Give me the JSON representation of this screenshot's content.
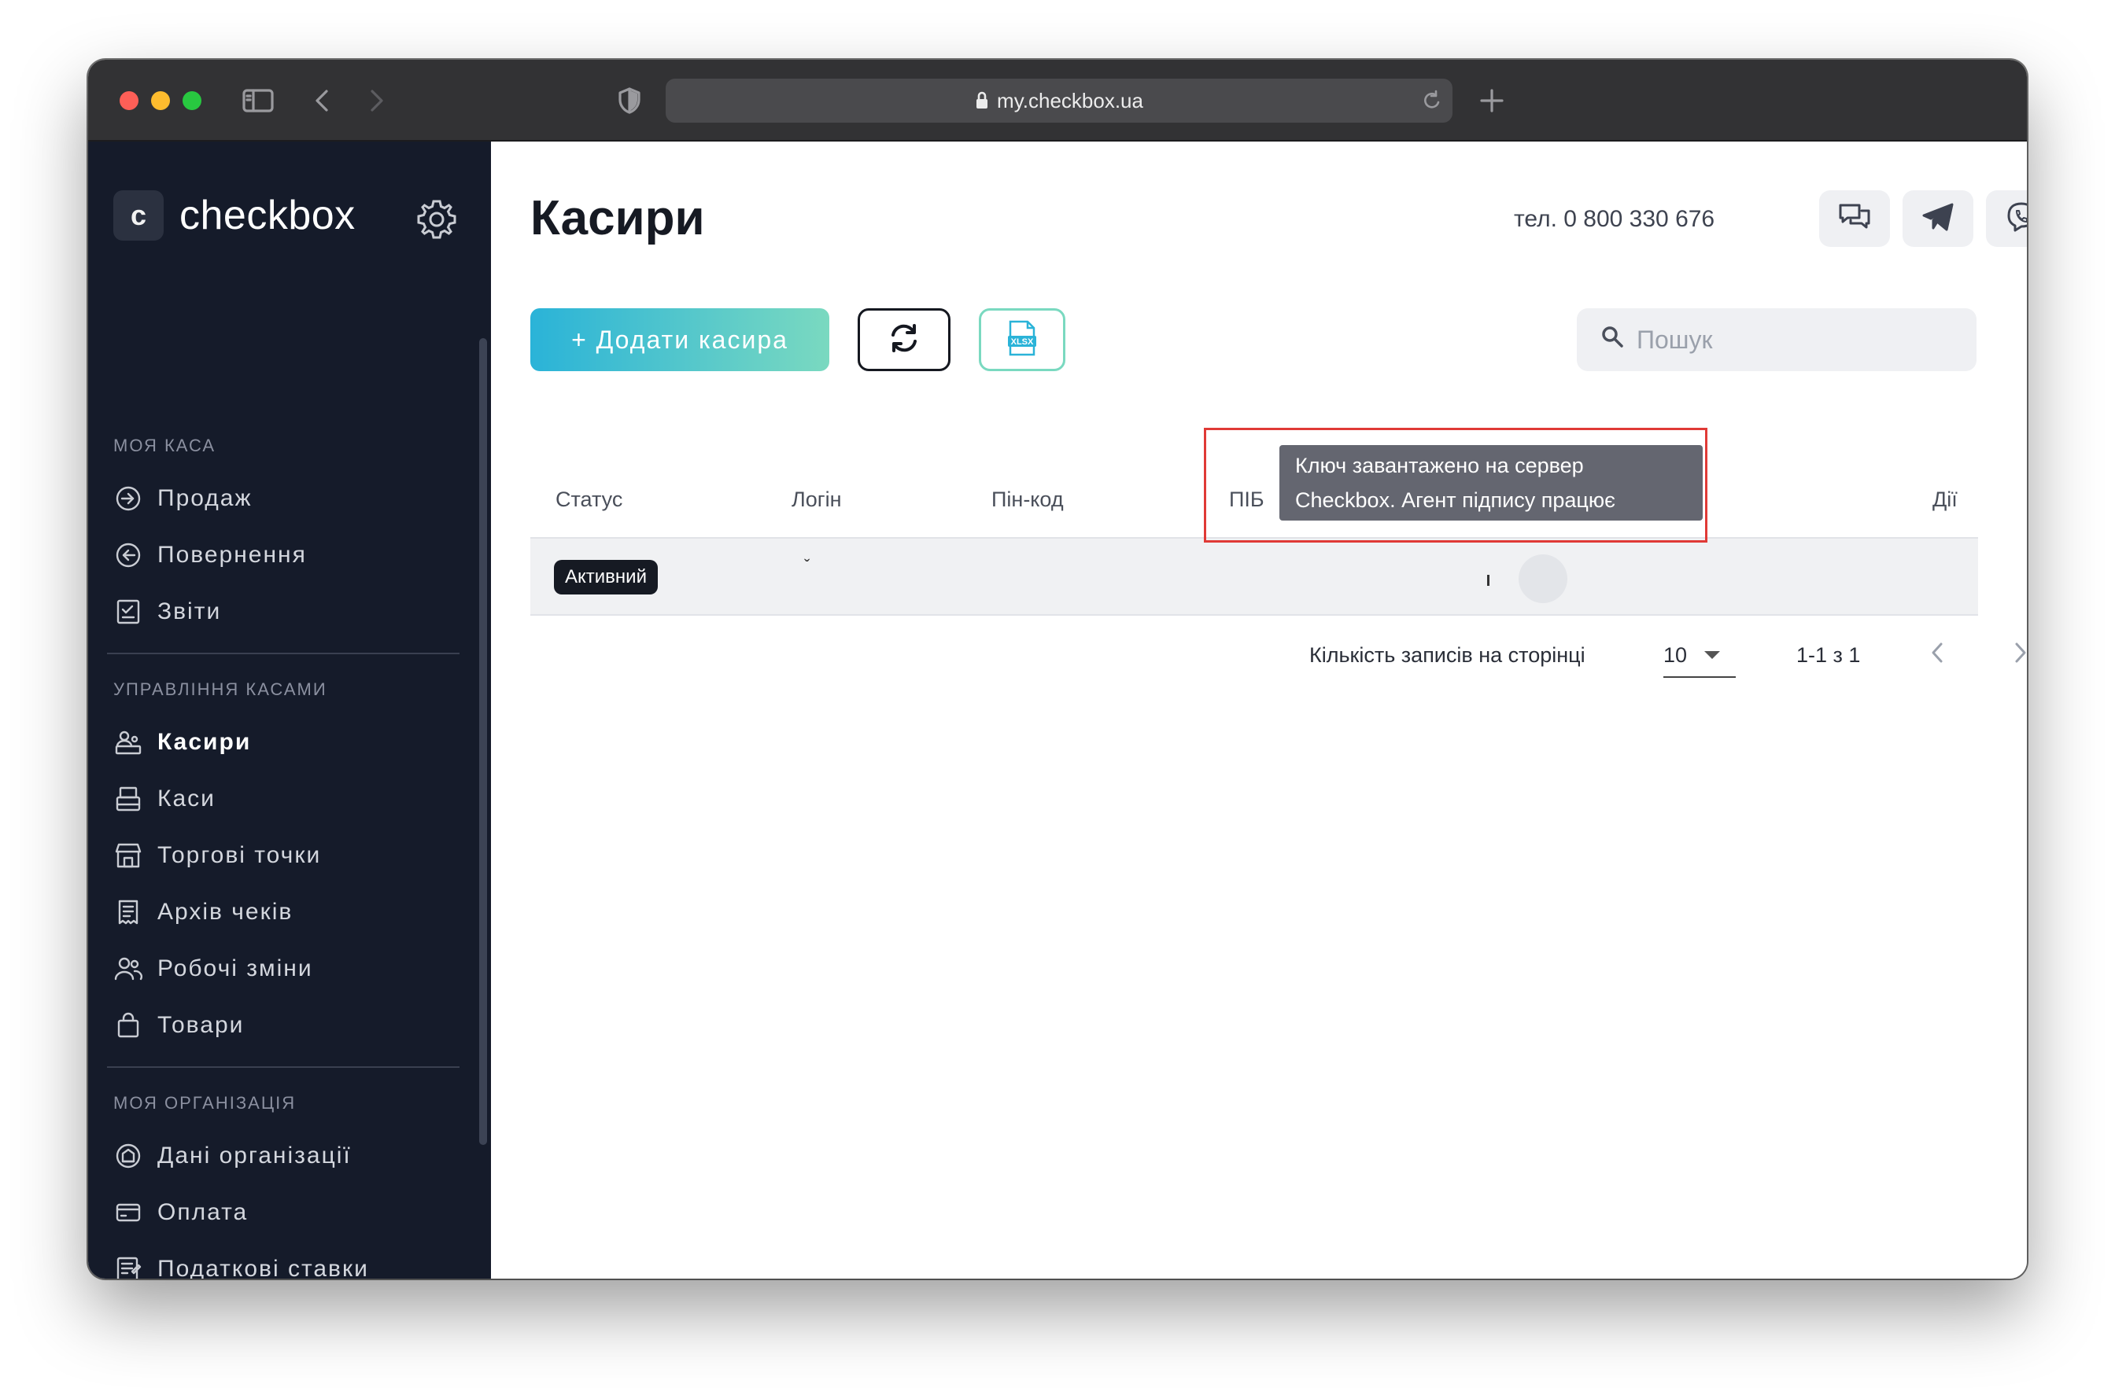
{
  "browser": {
    "url": "my.checkbox.ua"
  },
  "sidebar": {
    "logo_letter": "c",
    "logo_text": "checkbox",
    "sections": [
      {
        "title": "МОЯ КАСА",
        "items": [
          {
            "label": "Продаж",
            "icon": "sale-icon"
          },
          {
            "label": "Повернення",
            "icon": "return-icon"
          },
          {
            "label": "Звіти",
            "icon": "reports-icon"
          }
        ]
      },
      {
        "title": "УПРАВЛІННЯ КАСАМИ",
        "items": [
          {
            "label": "Касири",
            "icon": "cashiers-icon",
            "active": true
          },
          {
            "label": "Каси",
            "icon": "cash-register-icon"
          },
          {
            "label": "Торгові точки",
            "icon": "store-icon"
          },
          {
            "label": "Архів чеків",
            "icon": "receipt-archive-icon"
          },
          {
            "label": "Робочі зміни",
            "icon": "shifts-icon"
          },
          {
            "label": "Товари",
            "icon": "goods-bag-icon"
          }
        ]
      },
      {
        "title": "МОЯ ОРГАНІЗАЦІЯ",
        "items": [
          {
            "label": "Дані організації",
            "icon": "organization-icon"
          },
          {
            "label": "Оплата",
            "icon": "payment-card-icon"
          },
          {
            "label": "Податкові ставки",
            "icon": "tax-rates-icon"
          }
        ]
      }
    ]
  },
  "header": {
    "title": "Касири",
    "phone": "тел. 0 800 330 676"
  },
  "toolbar": {
    "add_label": "+ Додати касира",
    "search_placeholder": "Пошук",
    "xlsx_label": "XLSX"
  },
  "table": {
    "columns": [
      "Статус",
      "Логін",
      "Пін-код",
      "ПІБ",
      "Дії"
    ],
    "rows": [
      {
        "status": "Активний",
        "login": "ˇ",
        "pin": "",
        "name": ""
      }
    ]
  },
  "tooltip": {
    "line1": "Ключ завантажено на сервер",
    "line2": "Checkbox. Агент підпису працює"
  },
  "pagination": {
    "per_page_label": "Кількість записів на сторінці",
    "per_page_value": "10",
    "range": "1-1 з 1"
  },
  "colors": {
    "sidebar_bg": "#151b2a",
    "accent_gradient_start": "#2ab3d8",
    "accent_gradient_end": "#7ad9c0",
    "highlight_border": "#e03a36"
  }
}
